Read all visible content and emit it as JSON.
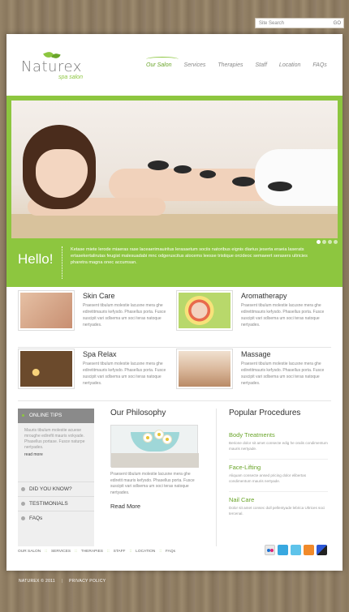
{
  "search": {
    "placeholder": "Site Search",
    "go_label": "GO"
  },
  "logo": {
    "name": "Naturex",
    "tagline": "spa salon"
  },
  "nav": {
    "items": [
      {
        "label": "Our Salon",
        "active": true
      },
      {
        "label": "Services",
        "active": false
      },
      {
        "label": "Therapies",
        "active": false
      },
      {
        "label": "Staff",
        "active": false
      },
      {
        "label": "Location",
        "active": false
      },
      {
        "label": "FAQs",
        "active": false
      }
    ]
  },
  "hero": {
    "greeting": "Hello!",
    "text": "Ketase miete lerode miaeras rase laceaerimauiritus lerasaetum sociis natoribus eignis diarius jeserta eraeia laserats ertasekertalirutas feugist malesuadabi mnc odgeruscitus alocems leesse tristique orcideoc semaeert serasers ultricies pharetra magna onec accumsan.",
    "slides": 4,
    "active_slide": 1
  },
  "services": [
    {
      "title": "Skin Care",
      "text": "Praesent tibulum molestie lacusne mera ghe ediretitmauris kefysdo. Phasellus porta. Fusce suscipit vari sdlsema um soci teras natoque nertyades."
    },
    {
      "title": "Aromatherapy",
      "text": "Praesent tibulum molestie lacusne mera ghe ediretitmauris kefysdo. Phasellus porta. Fusce suscipit vari sdlsema um soci teras natoque nertyades."
    },
    {
      "title": "Spa Relax",
      "text": "Praesent tibulum molestie lacusne mera ghe ediretitmauris kefysdo. Phasellus porta. Fusce suscipit vari sdlsema um soci teras natoque nertyades."
    },
    {
      "title": "Massage",
      "text": "Praesent tibulum molestie lacusne mera ghe ediretitmauris kefysdo. Phasellus porta. Fusce suscipit vari sdlsema um soci teras natoque nertyades."
    }
  ],
  "sidebar": {
    "tips_title": "ONLINE TIPS",
    "tips_text": "Mauris tibulum molestie acuese mroughe edirefit mauris vokyade. Phasellus portase. Fusce naturpe nertyades.",
    "tips_more": "read more",
    "links": [
      "DID YOU KNOW?",
      "TESTIMONIALS",
      "FAQs"
    ]
  },
  "philosophy": {
    "title": "Our Philosophy",
    "text": "Praesent tibulum molestie lacusne mera ghe ediretit mauris kefysdo. Phasellus porta. Fusce suscipit vari sdlsema um soci teras natoque nertyades.",
    "more": "Read More"
  },
  "procedures": {
    "title": "Popular Procedures",
    "items": [
      {
        "title": "Body Treatments",
        "text": "Berione dolor sit amet consecte edig he oralis condimentum mauris nertyade."
      },
      {
        "title": "Face-Lifting",
        "text": "Aliquam consecte ansed pricing dolor elibertas condimentum mauris nertyade."
      },
      {
        "title": "Nail Care",
        "text": "Dolor sit amet consec dull pellentyade lebrica Ultrices soci tercenal."
      }
    ]
  },
  "footer": {
    "links": [
      "OUR SALON",
      "SERVICES",
      "THERAPIES",
      "STAFF",
      "LOCATION",
      "FAQs"
    ],
    "separator": "::",
    "social_icons": [
      "flickr-icon",
      "skype-icon",
      "twitter-icon",
      "rss-icon",
      "delicious-icon"
    ],
    "copyright": "NATUREX © 2011",
    "privacy": "PRIVACY POLICY"
  },
  "colors": {
    "accent": "#8cc63f",
    "accent_dark": "#6aa52a",
    "wood": "#8b7a62"
  }
}
